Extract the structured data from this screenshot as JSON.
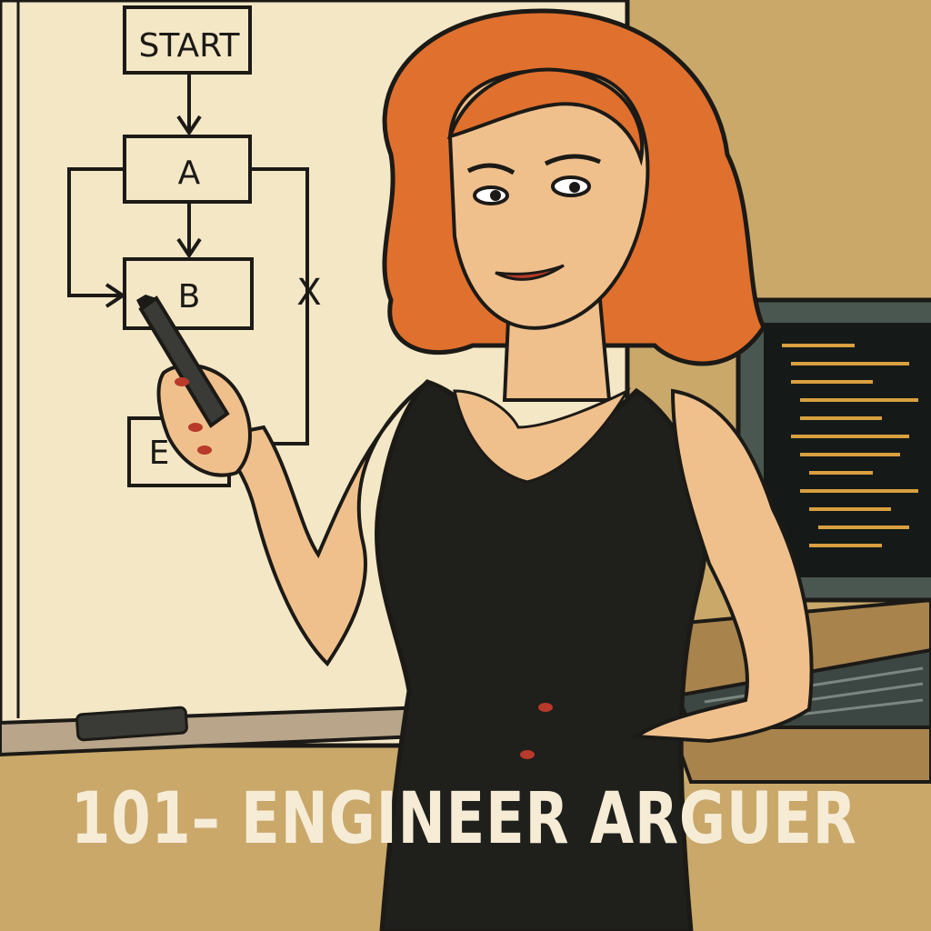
{
  "caption": "101– ENGINEER ARGUER",
  "flowchart": {
    "nodes": {
      "start": "START",
      "a": "A",
      "b": "B",
      "e": "E"
    },
    "rejected_path_mark": "X"
  },
  "colors": {
    "wall": "#c9a86a",
    "whiteboard": "#f4e7c6",
    "hair": "#e0702e",
    "skin": "#f0c08c",
    "dress": "#1f1f1c",
    "ink": "#1c1a16",
    "caption_text": "#f6ecd6",
    "monitor_code": "#d9a040"
  },
  "icons": [
    "pen-icon",
    "eraser-icon",
    "keyboard-icon",
    "monitor-icon"
  ]
}
